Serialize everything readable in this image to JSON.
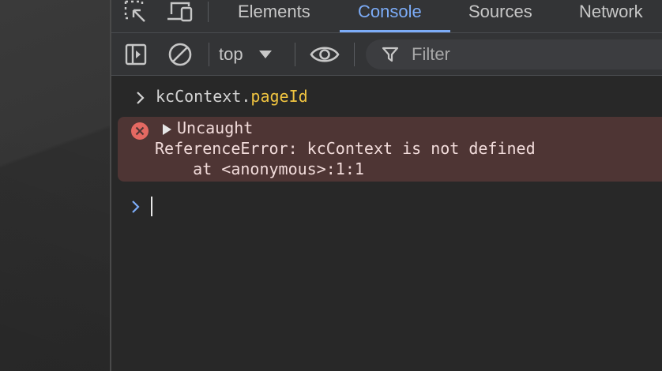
{
  "tabs": [
    {
      "label": "Elements",
      "active": false
    },
    {
      "label": "Console",
      "active": true
    },
    {
      "label": "Sources",
      "active": false
    },
    {
      "label": "Network",
      "active": false
    }
  ],
  "toolbar": {
    "context": "top",
    "filter_placeholder": "Filter"
  },
  "console": {
    "command_object": "kcContext",
    "command_dot": ".",
    "command_property": "pageId",
    "error": {
      "summary": "Uncaught",
      "message": "ReferenceError: kcContext is not defined",
      "stack": "    at <anonymous>:1:1"
    }
  },
  "colors": {
    "accent": "#7cacf8",
    "error_bg": "#4e3534",
    "error_icon": "#e46962",
    "property": "#f0c440",
    "prompt": "#7cacf8"
  },
  "icons": {
    "inspect": "inspect-element-icon",
    "device": "device-toolbar-icon",
    "sidebar": "sidebar-toggle-icon",
    "clear": "clear-console-icon",
    "eye": "live-expression-eye-icon",
    "filter": "filter-funnel-icon",
    "error": "error-circle-icon"
  }
}
